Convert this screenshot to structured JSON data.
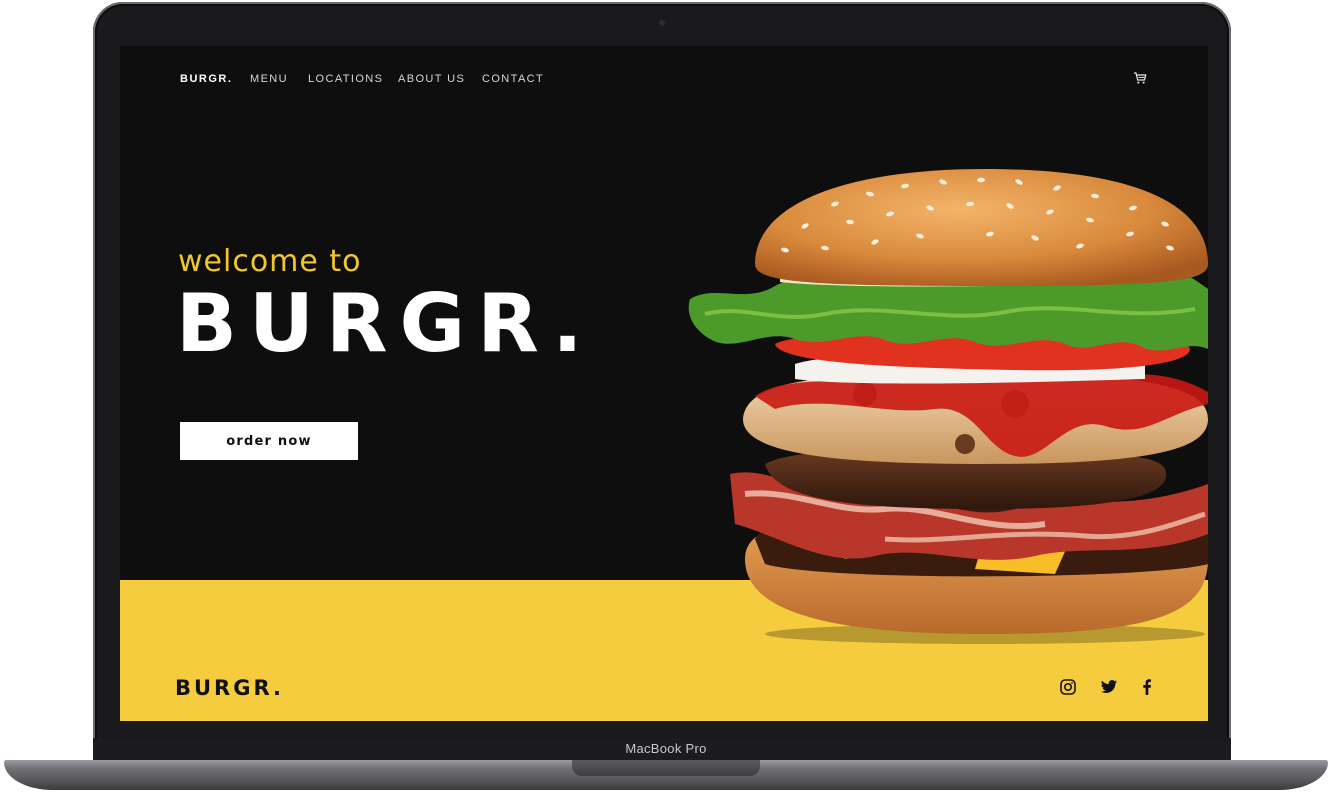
{
  "device": {
    "label": "MacBook Pro"
  },
  "nav": {
    "logo": "BURGR.",
    "links": [
      "MENU",
      "LOCATIONS",
      "ABOUT US",
      "CONTACT"
    ],
    "cart_icon": "cart-icon"
  },
  "hero": {
    "greeting": "welcome to",
    "title": "BURGR.",
    "cta_label": "order now",
    "image": "burger-photo"
  },
  "footer": {
    "logo": "BURGR.",
    "social_icons": [
      "instagram-icon",
      "twitter-icon",
      "facebook-icon"
    ]
  },
  "colors": {
    "background": "#0e0e0f",
    "accent": "#f2c72e",
    "band": "#f6cc3f",
    "text": "#ffffff"
  }
}
